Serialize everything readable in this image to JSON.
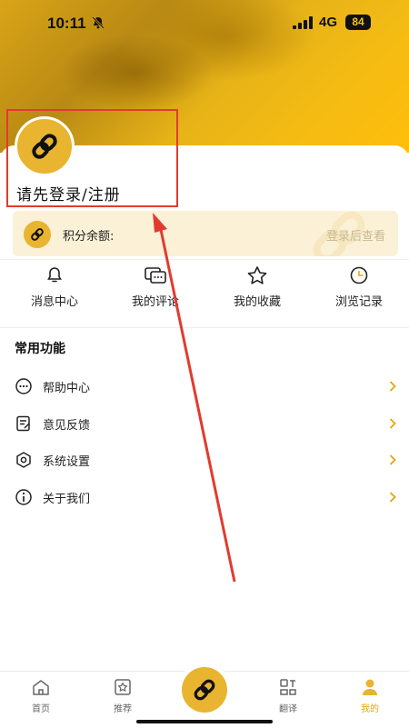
{
  "status_bar": {
    "time": "10:11",
    "network": "4G",
    "battery": "84"
  },
  "profile": {
    "login_text": "请先登录/注册"
  },
  "points": {
    "label": "积分余额:",
    "hint": "登录后查看"
  },
  "quick_actions": [
    {
      "label": "消息中心",
      "icon": "bell-icon"
    },
    {
      "label": "我的评论",
      "icon": "comment-icon"
    },
    {
      "label": "我的收藏",
      "icon": "star-icon"
    },
    {
      "label": "浏览记录",
      "icon": "clock-icon"
    }
  ],
  "common": {
    "title": "常用功能",
    "items": [
      {
        "label": "帮助中心",
        "icon": "dots-circle-icon"
      },
      {
        "label": "意见反馈",
        "icon": "feedback-icon"
      },
      {
        "label": "系统设置",
        "icon": "settings-icon"
      },
      {
        "label": "关于我们",
        "icon": "info-icon"
      }
    ]
  },
  "tabbar": {
    "tabs": [
      {
        "label": "首页",
        "icon": "home-icon"
      },
      {
        "label": "推荐",
        "icon": "recommend-icon"
      },
      {
        "label": "",
        "icon": "link-icon"
      },
      {
        "label": "翻译",
        "icon": "translate-icon"
      },
      {
        "label": "我的",
        "icon": "user-icon",
        "active": true
      }
    ]
  },
  "colors": {
    "accent": "#e9b430",
    "highlight": "#e23b2e",
    "active_tab": "#e5a50c"
  }
}
